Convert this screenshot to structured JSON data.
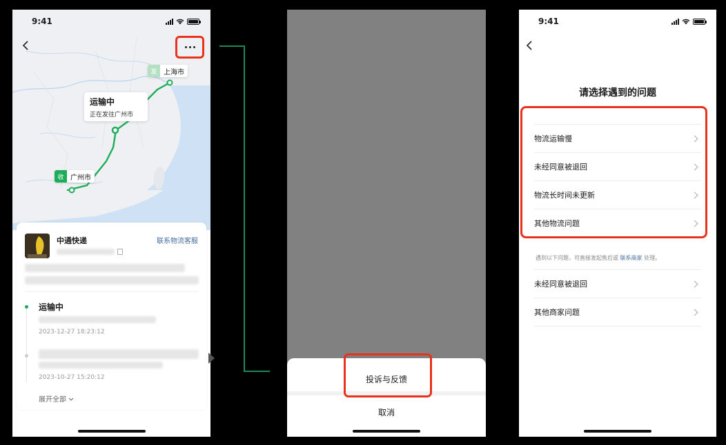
{
  "colors": {
    "accent_green": "#1dac58",
    "highlight_red": "#e8321c",
    "link_blue": "#4a6da0",
    "overlay_gray": "#818181"
  },
  "screen1": {
    "status_time": "9:41",
    "map": {
      "origin_badge": "发",
      "origin_city": "上海市",
      "dest_badge": "收",
      "dest_city": "广州市",
      "transit_status": "运输中",
      "transit_sub": "正在发往广州市"
    },
    "courier": {
      "name": "中通快递",
      "contact_link": "联系物流客服"
    },
    "timeline": {
      "status": "运输中",
      "time1": "2023-12-27 18:23:12",
      "time2": "2023-10-27 15:20:12",
      "expand_label": "展开全部"
    }
  },
  "screen2": {
    "report_label": "投诉与反馈",
    "cancel_label": "取消"
  },
  "screen3": {
    "status_time": "9:41",
    "title": "请选择遇到的问题",
    "logistics_issues": [
      "物流运输慢",
      "未经同意被退回",
      "物流长时间未更新",
      "其他物流问题"
    ],
    "hint_prefix": "遇到以下问题，可直接发起售后或",
    "hint_link": "联系商家",
    "hint_suffix": "处理。",
    "merchant_issues": [
      "未经同意被退回",
      "其他商家问题"
    ]
  },
  "icons": {
    "back": "chevron-left-icon",
    "more": "more-dots-icon",
    "chevron": "chevron-right-icon",
    "copy": "copy-icon",
    "expand": "chevron-down-icon"
  }
}
